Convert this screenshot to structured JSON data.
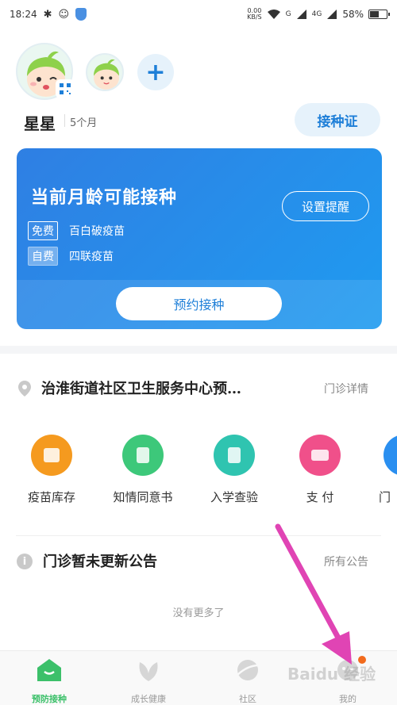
{
  "status_bar": {
    "time": "18:24",
    "net_speed_value": "0.00",
    "net_speed_unit": "KB/S",
    "network_1": "G",
    "network_2": "4G",
    "battery_text": "58%",
    "battery_level": 0.58,
    "icons": [
      "bluetooth-icon",
      "qq-icon",
      "shield-icon",
      "wifi-icon",
      "signal-icon",
      "battery-icon"
    ]
  },
  "profile": {
    "name": "星星",
    "age": "5个月",
    "certificate_button": "接种证",
    "add_icon": "+"
  },
  "vaccine_card": {
    "title": "当前月龄可能接种",
    "remind_button": "设置提醒",
    "vaccines": [
      {
        "tag": "免费",
        "name": "百白破疫苗"
      },
      {
        "tag": "自费",
        "name": "四联疫苗"
      }
    ],
    "book_button": "预约接种"
  },
  "clinic": {
    "name": "治淮街道社区卫生服务中心预…",
    "detail_link": "门诊详情"
  },
  "services": [
    {
      "label": "疫苗库存",
      "color": "#f59a1f"
    },
    {
      "label": "知情同意书",
      "color": "#3dc87a"
    },
    {
      "label": "入学查验",
      "color": "#2fc4b0"
    },
    {
      "label": "支 付",
      "color": "#f0508a"
    },
    {
      "label": "门",
      "color": "#2a8ff0"
    }
  ],
  "notice": {
    "title": "门诊暂未更新公告",
    "all_link": "所有公告",
    "info_glyph": "i",
    "empty_text": "没有更多了"
  },
  "tabbar": {
    "items": [
      {
        "label": "预防接种",
        "active": true
      },
      {
        "label": "成长健康",
        "active": false
      },
      {
        "label": "社区",
        "active": false
      },
      {
        "label": "我的",
        "active": false
      }
    ]
  },
  "watermark": "Baidu 经验",
  "colors": {
    "accent_blue": "#1e7fd8",
    "active_green": "#3cc06a",
    "annotation_arrow": "#e044b4"
  }
}
